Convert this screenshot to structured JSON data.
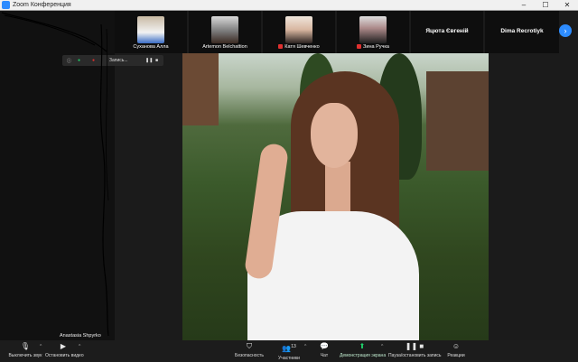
{
  "window": {
    "title": "Zoom Конференция",
    "min": "–",
    "max": "☐",
    "close": "✕"
  },
  "participants": [
    {
      "name": "Суханова Алла",
      "muted": false,
      "type": "video"
    },
    {
      "name": "Artemon Belchattion",
      "muted": false,
      "type": "video"
    },
    {
      "name": "Катя Шевченко",
      "muted": true,
      "type": "video"
    },
    {
      "name": "Зина Ручка",
      "muted": true,
      "type": "video"
    },
    {
      "name": "Яцюта Євгеній",
      "muted": false,
      "type": "name"
    },
    {
      "name": "Dima Recrotiyk",
      "muted": false,
      "type": "name"
    }
  ],
  "next_button": "›",
  "recording": {
    "label": "Запись...",
    "pause": "❚❚",
    "stop": "■"
  },
  "self_view": {
    "name": "Anastasia Shpyrko"
  },
  "toolbar": {
    "mute_label": "Выключить звук",
    "video_label": "Остановить видео",
    "security_label": "Безопасность",
    "participants_label": "Участники",
    "participants_count": "13",
    "chat_label": "Чат",
    "share_label": "Демонстрация экрана",
    "record_label": "Пауза/остановить запись",
    "reactions_label": "Реакции"
  }
}
